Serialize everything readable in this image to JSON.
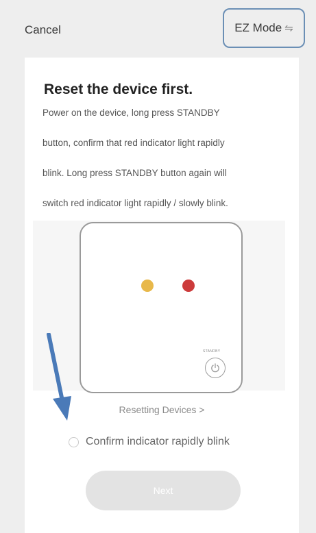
{
  "header": {
    "cancel_label": "Cancel",
    "mode_label": "EZ Mode",
    "mode_icon": "⇋"
  },
  "card": {
    "title": "Reset the device first.",
    "instructions": [
      "Power on the device, long press STANDBY",
      "button, confirm that red indicator light rapidly",
      "blink. Long press STANDBY button again will",
      "switch red indicator light rapidly / slowly blink."
    ],
    "illustration": {
      "standby_label": "STANDBY",
      "led_colors": [
        "#e8b84a",
        "#cc3b3b"
      ]
    },
    "resetting_link": "Resetting Devices >",
    "confirm_label": "Confirm indicator rapidly blink",
    "next_label": "Next"
  },
  "colors": {
    "background": "#eeeeee",
    "card": "#ffffff",
    "mode_border": "#6b8fb5",
    "arrow": "#4a7ab8",
    "next_disabled": "#e3e3e3"
  }
}
